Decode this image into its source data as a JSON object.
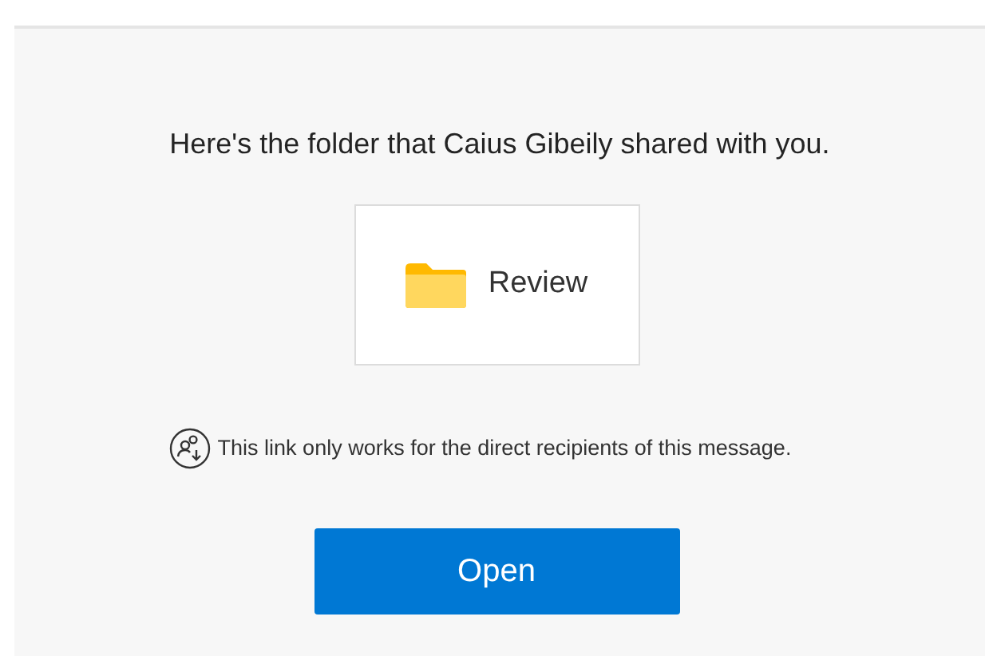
{
  "message": "Here's the folder that Caius Gibeily shared with you.",
  "folder": {
    "name": "Review"
  },
  "notice": "This link only works for the direct recipients of this message.",
  "button": {
    "label": "Open"
  }
}
